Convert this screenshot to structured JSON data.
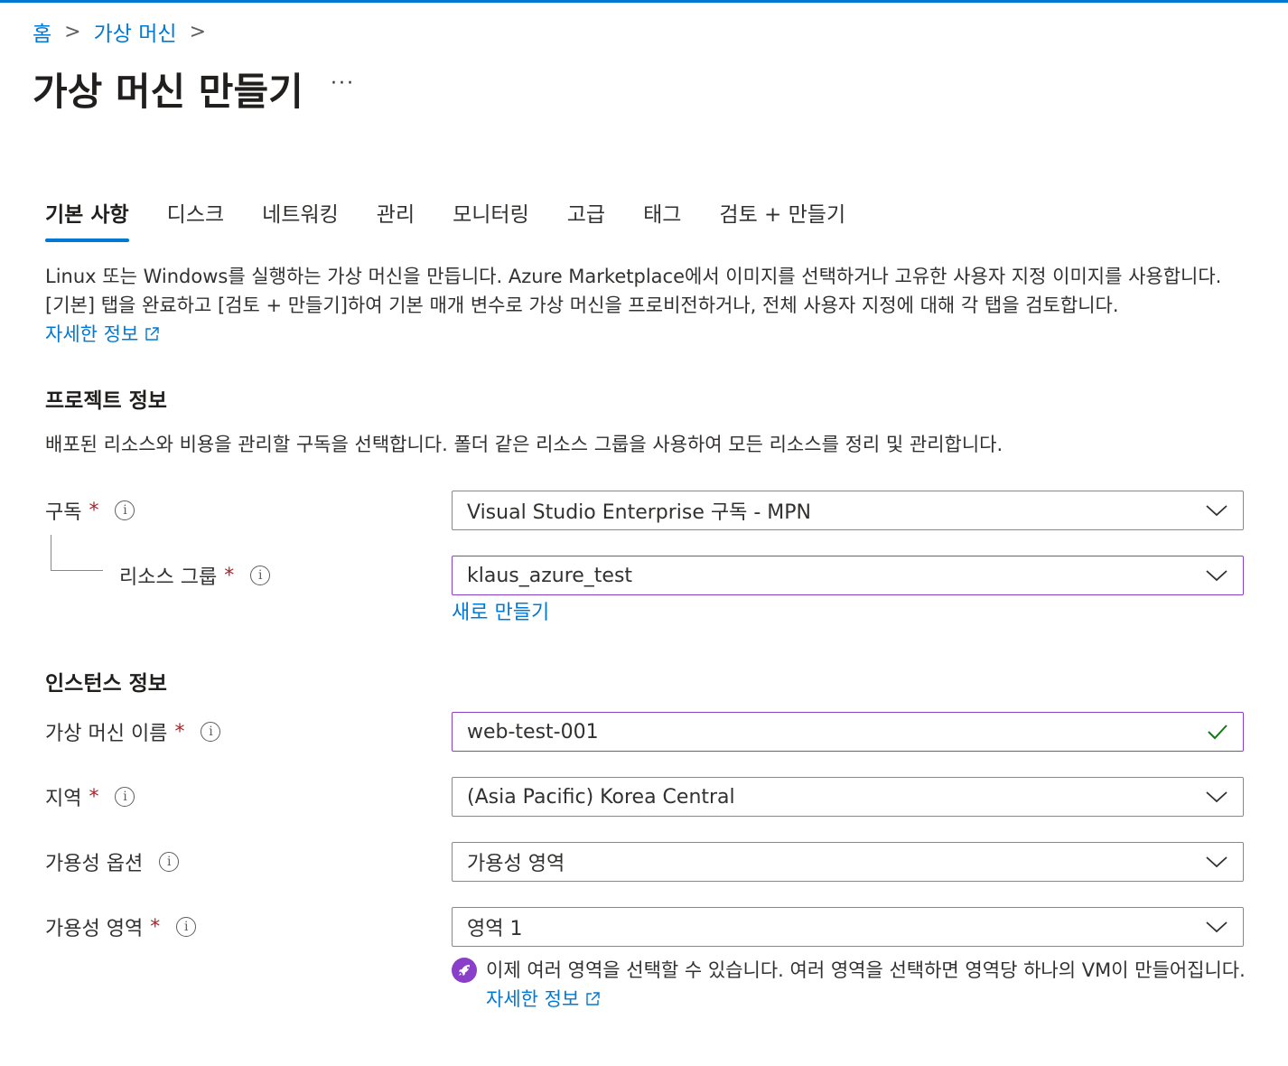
{
  "breadcrumb": {
    "home": "홈",
    "vm": "가상 머신",
    "sep": ">"
  },
  "page": {
    "title": "가상 머신 만들기",
    "more": "···"
  },
  "tabs": [
    {
      "label": "기본 사항",
      "active": true
    },
    {
      "label": "디스크"
    },
    {
      "label": "네트워킹"
    },
    {
      "label": "관리"
    },
    {
      "label": "모니터링"
    },
    {
      "label": "고급"
    },
    {
      "label": "태그"
    },
    {
      "label": "검토 + 만들기"
    }
  ],
  "intro": {
    "text": "Linux 또는 Windows를 실행하는 가상 머신을 만듭니다. Azure Marketplace에서 이미지를 선택하거나 고유한 사용자 지정 이미지를 사용합니다. [기본] 탭을 완료하고 [검토 + 만들기]하여 기본 매개 변수로 가상 머신을 프로비전하거나, 전체 사용자 지정에 대해 각 탭을 검토합니다.",
    "learn_more": "자세한 정보"
  },
  "project": {
    "heading": "프로젝트 정보",
    "description": "배포된 리소스와 비용을 관리할 구독을 선택합니다. 폴더 같은 리소스 그룹을 사용하여 모든 리소스를 정리 및 관리합니다.",
    "subscription": {
      "label": "구독",
      "value": "Visual Studio Enterprise 구독 - MPN"
    },
    "resource_group": {
      "label": "리소스 그룹",
      "value": "klaus_azure_test",
      "create_new": "새로 만들기"
    }
  },
  "instance": {
    "heading": "인스턴스 정보",
    "vm_name": {
      "label": "가상 머신 이름",
      "value": "web-test-001"
    },
    "region": {
      "label": "지역",
      "value": "(Asia Pacific) Korea Central"
    },
    "availability_options": {
      "label": "가용성 옵션",
      "value": "가용성 영역"
    },
    "availability_zone": {
      "label": "가용성 영역",
      "value": "영역 1"
    },
    "zone_note": "이제 여러 영역을 선택할 수 있습니다. 여러 영역을 선택하면 영역당 하나의 VM이 만들어집니다.",
    "zone_note_link": "자세한 정보"
  },
  "ui": {
    "required_mark": "*",
    "info_glyph": "i"
  },
  "colors": {
    "accent": "#0078d4",
    "required": "#a4262c",
    "focus_border": "#8a3fc8",
    "success": "#107c10"
  }
}
